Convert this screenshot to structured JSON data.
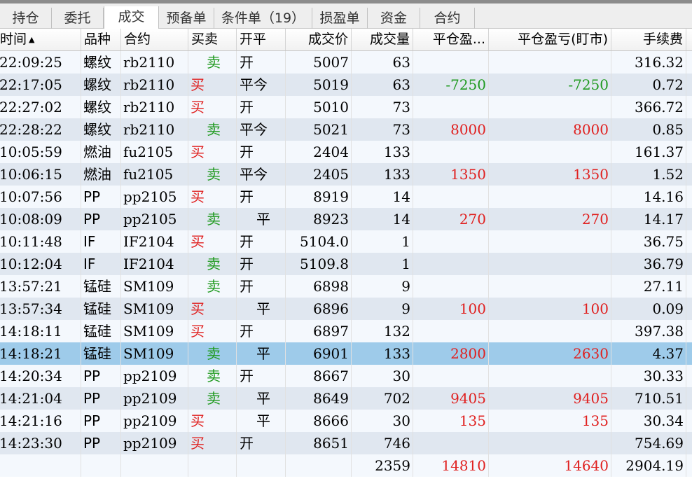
{
  "tabs": [
    {
      "label": "持仓",
      "active": false
    },
    {
      "label": "委托",
      "active": false
    },
    {
      "label": "成交",
      "active": true
    },
    {
      "label": "预备单",
      "active": false
    },
    {
      "label": "条件单（19）",
      "active": false
    },
    {
      "label": "损盈单",
      "active": false
    },
    {
      "label": "资金",
      "active": false
    },
    {
      "label": "合约",
      "active": false
    }
  ],
  "columns": [
    "时间",
    "品种",
    "合约",
    "买卖",
    "开平",
    "成交价",
    "成交量",
    "平仓盈...",
    "平仓盈亏(盯市)",
    "手续费"
  ],
  "sort_indicator": "▲",
  "rows": [
    {
      "time": "22:09:25",
      "product": "螺纹",
      "contract": "rb2110",
      "side": "卖",
      "offset": "开",
      "price": "5007",
      "volume": "63",
      "close_pl": "",
      "close_pl_mtm": "",
      "fee": "316.32"
    },
    {
      "time": "22:17:05",
      "product": "螺纹",
      "contract": "rb2110",
      "side": "买",
      "offset": "平今",
      "price": "5019",
      "volume": "63",
      "close_pl": "-7250",
      "close_pl_mtm": "-7250",
      "fee": "0.72"
    },
    {
      "time": "22:27:02",
      "product": "螺纹",
      "contract": "rb2110",
      "side": "买",
      "offset": "开",
      "price": "5010",
      "volume": "73",
      "close_pl": "",
      "close_pl_mtm": "",
      "fee": "366.72"
    },
    {
      "time": "22:28:22",
      "product": "螺纹",
      "contract": "rb2110",
      "side": "卖",
      "offset": "平今",
      "price": "5021",
      "volume": "73",
      "close_pl": "8000",
      "close_pl_mtm": "8000",
      "fee": "0.85"
    },
    {
      "time": "10:05:59",
      "product": "燃油",
      "contract": "fu2105",
      "side": "买",
      "offset": "开",
      "price": "2404",
      "volume": "133",
      "close_pl": "",
      "close_pl_mtm": "",
      "fee": "161.37"
    },
    {
      "time": "10:06:15",
      "product": "燃油",
      "contract": "fu2105",
      "side": "卖",
      "offset": "平今",
      "price": "2405",
      "volume": "133",
      "close_pl": "1350",
      "close_pl_mtm": "1350",
      "fee": "1.52"
    },
    {
      "time": "10:07:56",
      "product": "PP",
      "contract": "pp2105",
      "side": "买",
      "offset": "开",
      "price": "8919",
      "volume": "14",
      "close_pl": "",
      "close_pl_mtm": "",
      "fee": "14.16"
    },
    {
      "time": "10:08:09",
      "product": "PP",
      "contract": "pp2105",
      "side": "卖",
      "offset": "平",
      "price": "8923",
      "volume": "14",
      "close_pl": "270",
      "close_pl_mtm": "270",
      "fee": "14.17"
    },
    {
      "time": "10:11:48",
      "product": "IF",
      "contract": "IF2104",
      "side": "买",
      "offset": "开",
      "price": "5104.0",
      "volume": "1",
      "close_pl": "",
      "close_pl_mtm": "",
      "fee": "36.75"
    },
    {
      "time": "10:12:04",
      "product": "IF",
      "contract": "IF2104",
      "side": "卖",
      "offset": "开",
      "price": "5109.8",
      "volume": "1",
      "close_pl": "",
      "close_pl_mtm": "",
      "fee": "36.79"
    },
    {
      "time": "13:57:21",
      "product": "锰硅",
      "contract": "SM109",
      "side": "卖",
      "offset": "开",
      "price": "6898",
      "volume": "9",
      "close_pl": "",
      "close_pl_mtm": "",
      "fee": "27.11"
    },
    {
      "time": "13:57:34",
      "product": "锰硅",
      "contract": "SM109",
      "side": "买",
      "offset": "平",
      "price": "6896",
      "volume": "9",
      "close_pl": "100",
      "close_pl_mtm": "100",
      "fee": "0.09"
    },
    {
      "time": "14:18:11",
      "product": "锰硅",
      "contract": "SM109",
      "side": "买",
      "offset": "开",
      "price": "6897",
      "volume": "132",
      "close_pl": "",
      "close_pl_mtm": "",
      "fee": "397.38"
    },
    {
      "time": "14:18:21",
      "product": "锰硅",
      "contract": "SM109",
      "side": "卖",
      "offset": "平",
      "price": "6901",
      "volume": "133",
      "close_pl": "2800",
      "close_pl_mtm": "2630",
      "fee": "4.37",
      "selected": true
    },
    {
      "time": "14:20:34",
      "product": "PP",
      "contract": "pp2109",
      "side": "卖",
      "offset": "开",
      "price": "8667",
      "volume": "30",
      "close_pl": "",
      "close_pl_mtm": "",
      "fee": "30.33"
    },
    {
      "time": "14:21:04",
      "product": "PP",
      "contract": "pp2109",
      "side": "卖",
      "offset": "平",
      "price": "8649",
      "volume": "702",
      "close_pl": "9405",
      "close_pl_mtm": "9405",
      "fee": "710.51"
    },
    {
      "time": "14:21:16",
      "product": "PP",
      "contract": "pp2109",
      "side": "买",
      "offset": "平",
      "price": "8666",
      "volume": "30",
      "close_pl": "135",
      "close_pl_mtm": "135",
      "fee": "30.34"
    },
    {
      "time": "14:23:30",
      "product": "PP",
      "contract": "pp2109",
      "side": "买",
      "offset": "开",
      "price": "8651",
      "volume": "746",
      "close_pl": "",
      "close_pl_mtm": "",
      "fee": "754.69"
    }
  ],
  "totals": {
    "volume": "2359",
    "close_pl": "14810",
    "close_pl_mtm": "14640",
    "fee": "2904.19"
  },
  "colors": {
    "row_even": "#f4f8fd",
    "row_odd": "#e0e7f0",
    "row_selected": "#9ecbea",
    "buy": "#e0201f",
    "sell": "#1f9a1f",
    "profit": "#e0201f",
    "loss": "#1f9a1f"
  }
}
